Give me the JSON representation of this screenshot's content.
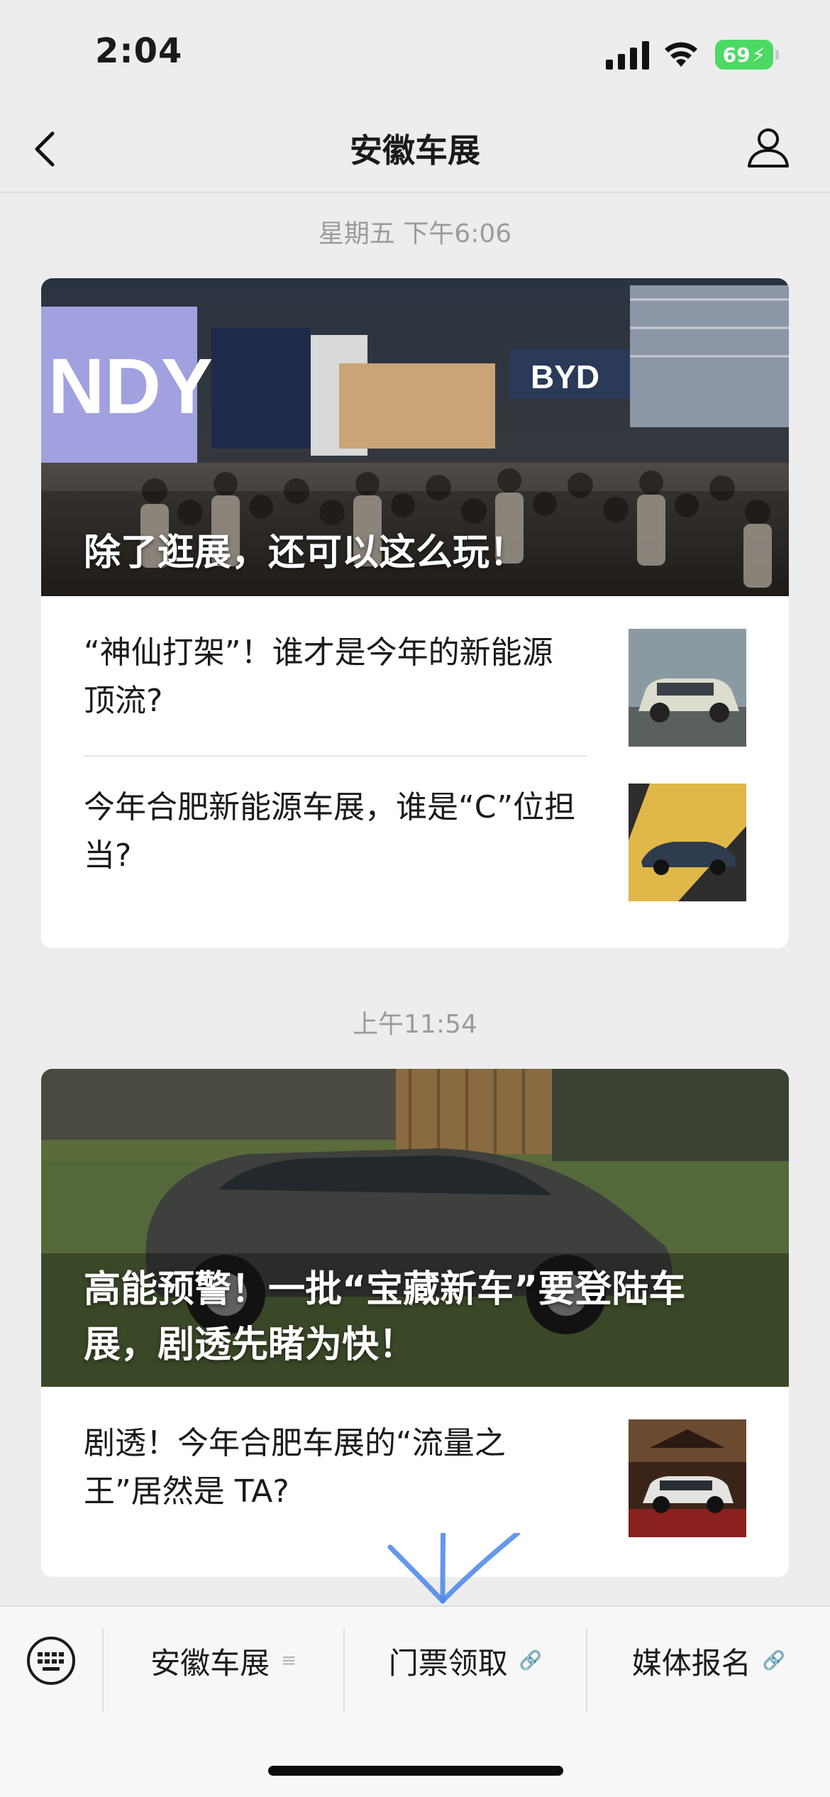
{
  "status_bar": {
    "time": "2:04",
    "battery": "69"
  },
  "nav": {
    "title": "安徽车展"
  },
  "timestamps": {
    "first": "星期五 下午6:06",
    "second": "上午11:54"
  },
  "feed": [
    {
      "hero_title": "除了逛展，还可以这么玩！",
      "articles": [
        {
          "title": "“神仙打架”！谁才是今年的新能源顶流?"
        },
        {
          "title": "今年合肥新能源车展，谁是“C”位担当?"
        }
      ]
    },
    {
      "hero_title": "高能预警！一批“宝藏新车”要登陆车展，剧透先睹为快！",
      "articles": [
        {
          "title": "剧透！今年合肥车展的“流量之王”居然是 TA?"
        }
      ]
    }
  ],
  "menu": {
    "items": [
      {
        "label": "安徽车展",
        "icon": "menu-lines-icon"
      },
      {
        "label": "门票领取",
        "icon": "link-icon"
      },
      {
        "label": "媒体报名",
        "icon": "link-icon"
      }
    ]
  },
  "colors": {
    "battery": "#4cd964",
    "background": "#ededed",
    "annotation": "#4a86e8"
  }
}
